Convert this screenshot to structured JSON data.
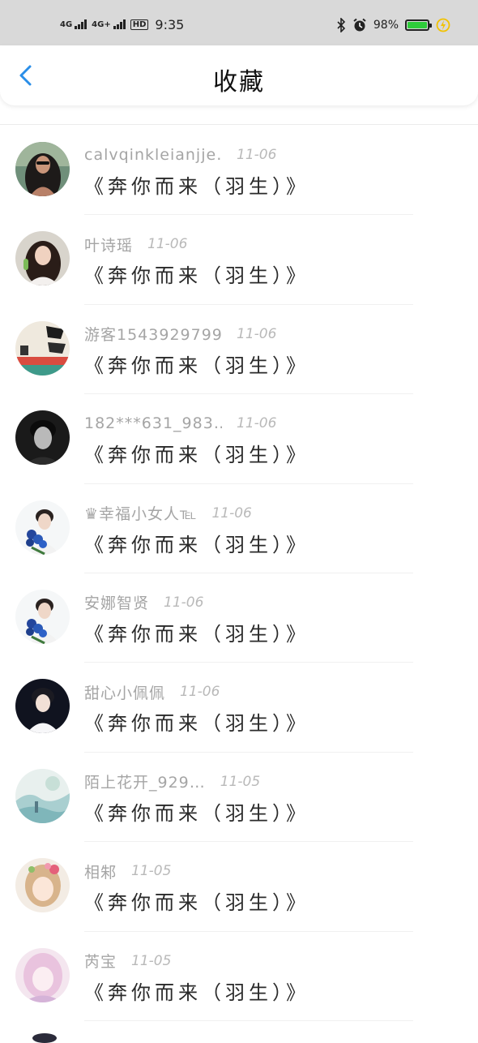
{
  "status_bar": {
    "network1": "4G",
    "network2": "4G+",
    "hd": "HD",
    "time": "9:35",
    "battery_percent": "98%",
    "battery_level": 0.98,
    "battery_color": "#2ecc3a"
  },
  "header": {
    "title": "收藏",
    "back_color": "#2a8ee8"
  },
  "favorites": [
    {
      "name": "calvqinkleianjje…",
      "date": "11-06",
      "subject": "《奔你而来（羽生）》",
      "avatar": "woman-sunglasses-avatar"
    },
    {
      "name": "叶诗瑶",
      "date": "11-06",
      "subject": "《奔你而来（羽生）》",
      "avatar": "girl-portrait-avatar"
    },
    {
      "name": "游客1543929799",
      "date": "11-06",
      "subject": "《奔你而来（羽生）》",
      "avatar": "calligraphy-avatar"
    },
    {
      "name": "182***631_983…",
      "date": "11-06",
      "subject": "《奔你而来（羽生）》",
      "avatar": "man-bw-avatar"
    },
    {
      "name": "♛幸福小女人℡",
      "date": "11-06",
      "subject": "《奔你而来（羽生）》",
      "avatar": "boy-roses-avatar"
    },
    {
      "name": "安娜智贤",
      "date": "11-06",
      "subject": "《奔你而来（羽生）》",
      "avatar": "boy-roses-avatar"
    },
    {
      "name": "甜心小佩佩",
      "date": "11-06",
      "subject": "《奔你而来（羽生）》",
      "avatar": "boy-dark-avatar"
    },
    {
      "name": "陌上花开_929…",
      "date": "11-05",
      "subject": "《奔你而来（羽生）》",
      "avatar": "landscape-avatar"
    },
    {
      "name": "相邾",
      "date": "11-05",
      "subject": "《奔你而来（羽生）》",
      "avatar": "anime-girl-flowers-avatar"
    },
    {
      "name": "芮宝",
      "date": "11-05",
      "subject": "《奔你而来（羽生）》",
      "avatar": "anime-girl-pink-avatar"
    }
  ]
}
